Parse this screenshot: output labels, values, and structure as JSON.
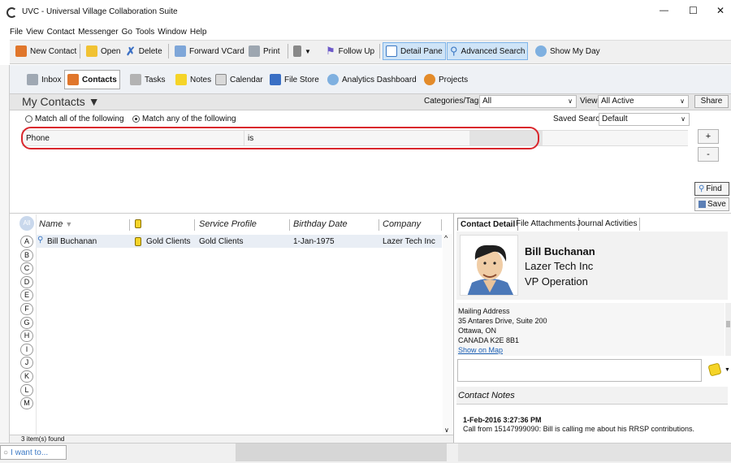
{
  "window": {
    "title": "UVC - Universal Village Collaboration Suite",
    "minimize": "—",
    "maximize": "☐",
    "close": "✕"
  },
  "menu": [
    "File",
    "View",
    "Contact",
    "Messenger",
    "Go",
    "Tools",
    "Window",
    "Help"
  ],
  "toolbar": {
    "new_contact": "New Contact",
    "open": "Open",
    "delete": "Delete",
    "forward_vcard": "Forward VCard",
    "print": "Print",
    "follow_up": "Follow Up",
    "detail_pane": "Detail Pane",
    "advanced_search": "Advanced Search",
    "show_my_day": "Show My Day"
  },
  "modules": {
    "inbox": "Inbox",
    "contacts": "Contacts",
    "tasks": "Tasks",
    "notes": "Notes",
    "calendar": "Calendar",
    "file_store": "File Store",
    "analytics": "Analytics Dashboard",
    "projects": "Projects"
  },
  "view_header": {
    "title": "My Contacts ▼",
    "categories_label": "Categories/Tags:",
    "categories_value": "All",
    "view_label": "View:",
    "view_value": "All Active",
    "share": "Share"
  },
  "search": {
    "match_all": "Match all of the following",
    "match_any": "Match any of the following",
    "match_any_selected": true,
    "saved_searches_label": "Saved Searches:",
    "saved_searches_value": "Default",
    "field": "Phone",
    "operator": "is",
    "value": "",
    "add": "+",
    "remove": "-",
    "find": "Find",
    "save": "Save"
  },
  "list": {
    "all_label": "All",
    "letters": [
      "A",
      "B",
      "C",
      "D",
      "E",
      "F",
      "G",
      "H",
      "I",
      "J",
      "K",
      "L",
      "M"
    ],
    "columns": [
      "Name",
      "",
      "Service Profile",
      "Birthday Date",
      "Company"
    ],
    "rows": [
      {
        "name": "Bill Buchanan",
        "category": "Gold Clients",
        "service_profile": "Gold Clients",
        "birthday": "1-Jan-1975",
        "company": "Lazer Tech Inc"
      }
    ],
    "status": "3 item(s) found"
  },
  "detail": {
    "tabs": [
      "Contact Detail",
      "File Attachments",
      "Journal Activities"
    ],
    "name": "Bill Buchanan",
    "company": "Lazer Tech Inc",
    "job_title": "VP Operation",
    "address_label": "Mailing Address",
    "address_line1": "35 Antares Drive, Suite 200",
    "address_line2": "Ottawa, ON",
    "address_line3": "CANADA K2E 8B1",
    "show_on_map": "Show on Map",
    "notes_label": "Contact Notes",
    "note_timestamp": "1-Feb-2016 3:27:36 PM",
    "note_text": "Call from 15147999090: Bill is calling me about his RRSP contributions."
  },
  "footer": {
    "i_want_to": "I want to..."
  },
  "colors": {
    "highlight_border": "#d9262c",
    "link": "#1a5fb4",
    "toolbar_bg": "#f0f0f0",
    "panel_bg": "#ececec"
  }
}
